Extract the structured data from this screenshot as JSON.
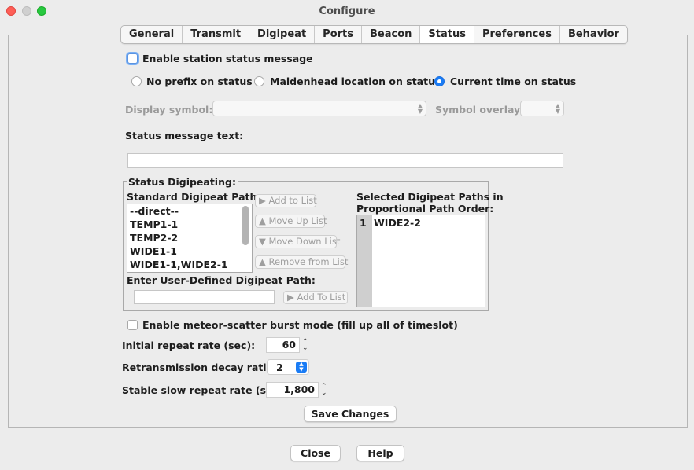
{
  "window": {
    "title": "Configure"
  },
  "tabs": [
    {
      "label": "General"
    },
    {
      "label": "Transmit"
    },
    {
      "label": "Digipeat"
    },
    {
      "label": "Ports"
    },
    {
      "label": "Beacon"
    },
    {
      "label": "Status"
    },
    {
      "label": "Preferences"
    },
    {
      "label": "Behavior"
    }
  ],
  "status": {
    "enable_label": "Enable station status message",
    "radio_options": [
      {
        "label": "No prefix on status",
        "selected": false
      },
      {
        "label": "Maidenhead location on status",
        "selected": false
      },
      {
        "label": "Current time on status",
        "selected": true
      }
    ],
    "display_symbol_label": "Display symbol:",
    "symbol_overlay_label": "Symbol overlay:",
    "message_text_label": "Status message text:",
    "message_text_value": ""
  },
  "digipeat": {
    "group_title": "Status Digipeating:",
    "standard_label": "Standard Digipeat Paths:",
    "standard_paths": [
      "--direct--",
      "TEMP1-1",
      "TEMP2-2",
      "WIDE1-1",
      "WIDE1-1,WIDE2-1"
    ],
    "add_to_list": "Add to List",
    "move_up": "Move Up List",
    "move_down": "Move Down List",
    "remove": "Remove from List",
    "selected_label_line1": "Selected Digipeat Paths in",
    "selected_label_line2": "Proportional Path Order:",
    "selected_paths": [
      {
        "index": "1",
        "path": "WIDE2-2"
      }
    ],
    "user_defined_label": "Enter User-Defined Digipeat Path:",
    "user_defined_value": "",
    "add_to_list_user": "Add To List"
  },
  "burst": {
    "meteor_label": "Enable meteor-scatter burst mode (fill up all of timeslot)",
    "initial_rate_label": "Initial repeat rate (sec):",
    "initial_rate_value": "60",
    "decay_label": "Retransmission decay ratio:",
    "decay_value": "2",
    "slow_rate_label": "Stable slow repeat rate (sec):",
    "slow_rate_value": "1,800"
  },
  "buttons": {
    "save": "Save Changes",
    "close": "Close",
    "help": "Help"
  },
  "colors": {
    "accent": "#1a7cf5",
    "close_dot": "#fe5f57",
    "max_dot": "#28c840"
  }
}
